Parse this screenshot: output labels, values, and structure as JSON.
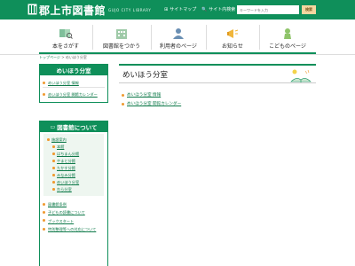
{
  "header": {
    "site_title": "郡上市図書館",
    "site_subtitle": "GUJO CITY LIBRARY",
    "sitemap_label": "サイトマップ",
    "site_search_label": "サイト内検索",
    "search_placeholder": "キーワードを入力",
    "search_button_label": "検索"
  },
  "nav": {
    "items": [
      {
        "label": "本をさがす",
        "icon": "book-search-icon"
      },
      {
        "label": "図書館をつかう",
        "icon": "building-icon"
      },
      {
        "label": "利用者のページ",
        "icon": "user-icon"
      },
      {
        "label": "お知らせ",
        "icon": "megaphone-icon"
      },
      {
        "label": "こどものページ",
        "icon": "child-icon"
      }
    ]
  },
  "breadcrumb": {
    "home": "トップページ",
    "separator": ">",
    "current": "めいほう分室"
  },
  "sidebar": {
    "section1": {
      "heading": "めいほう分室",
      "links": [
        "めいほう分室 情報",
        "めいほう分室 開館カレンダー"
      ]
    },
    "section2": {
      "heading": "図書館について",
      "group_heading": "施設案内",
      "branches": [
        "本館",
        "はちまん分館",
        "やまと分館",
        "たかす分館",
        "みなみ分館",
        "めいほう分室",
        "わら分室"
      ],
      "links": [
        "図書館条例",
        "子どもの読書について",
        "ブックスタート",
        "特別整理等への対応について"
      ]
    }
  },
  "main": {
    "title": "めいほう分室",
    "links": [
      "めいほう分室 情報",
      "めいほう分室 開館カレンダー"
    ]
  },
  "colors": {
    "brand_green": "#0f8f5a",
    "accent_orange": "#f09a30"
  }
}
